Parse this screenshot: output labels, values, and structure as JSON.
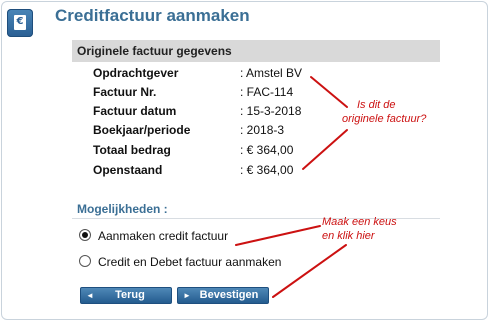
{
  "app": {
    "title": "Creditfactuur aanmaken",
    "icon": "credit-invoice-icon",
    "icon_glyph": "€"
  },
  "original_invoice": {
    "header": "Originele factuur gegevens",
    "rows": [
      {
        "label": "Opdrachtgever",
        "value": ": Amstel BV"
      },
      {
        "label": "Factuur Nr.",
        "value": ": FAC-114"
      },
      {
        "label": "Factuur datum",
        "value": ": 15-3-2018"
      },
      {
        "label": "Boekjaar/periode",
        "value": ": 2018-3"
      },
      {
        "label": "Totaal bedrag",
        "value": ": € 364,00"
      },
      {
        "label": "Openstaand",
        "value": ": € 364,00"
      }
    ]
  },
  "options": {
    "heading": "Mogelijkheden :",
    "items": [
      {
        "label": "Aanmaken credit factuur",
        "selected": true
      },
      {
        "label": "Credit en Debet factuur aanmaken",
        "selected": false
      }
    ]
  },
  "buttons": {
    "back": "Terug",
    "confirm": "Bevestigen"
  },
  "annotations": {
    "question_line1": "Is dit de",
    "question_line2": "originele factuur?",
    "instruction_line1": "Maak een keus",
    "instruction_line2": "en klik hier"
  },
  "colors": {
    "accent": "#3b6f95",
    "button": "#2f6a9c",
    "annotation": "#cc1111",
    "header_bg": "#d9d9d9"
  }
}
